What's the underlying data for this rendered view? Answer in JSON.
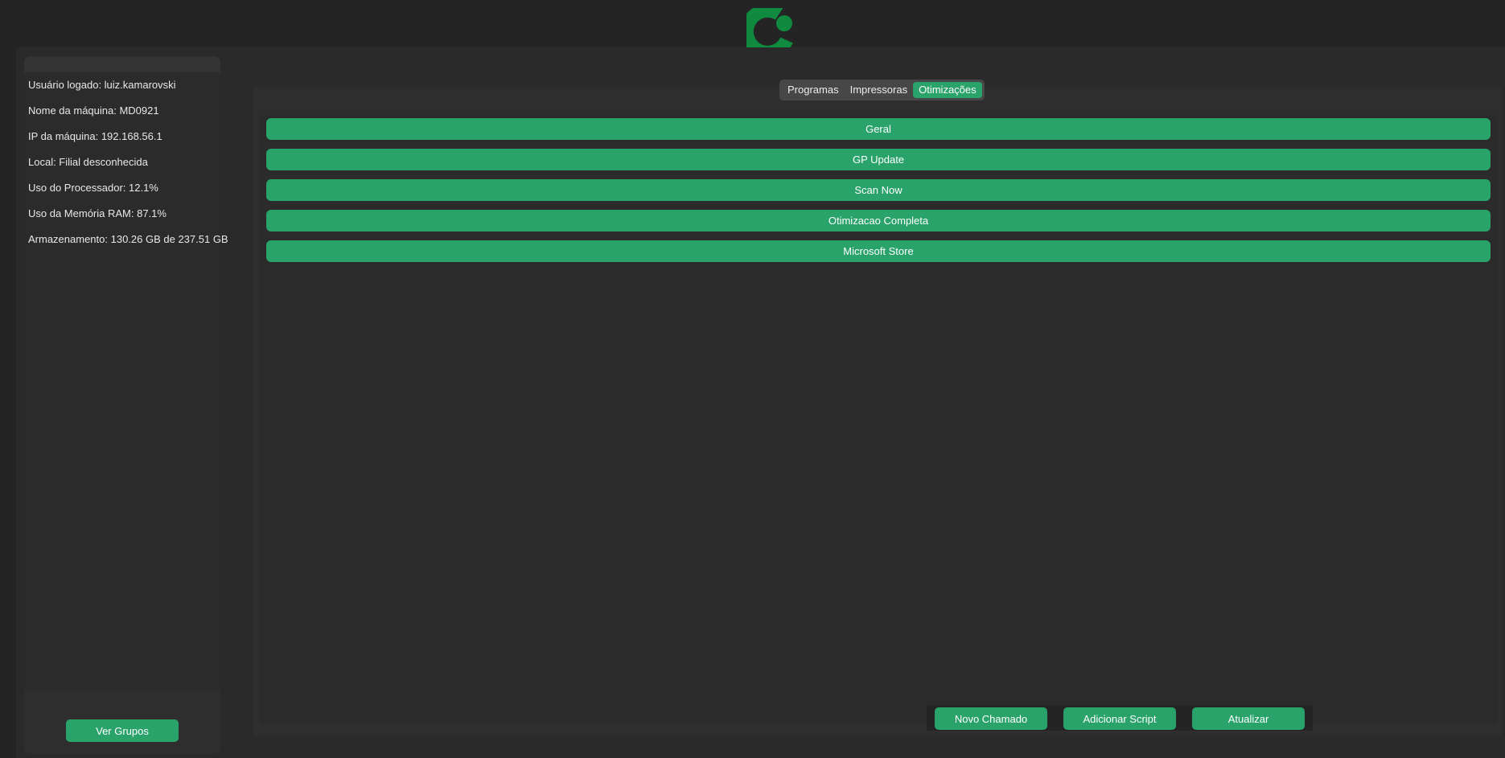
{
  "header": {
    "logo_icon": "app-logo-icon"
  },
  "sidebar": {
    "info": [
      "Usuário logado: luiz.kamarovski",
      "Nome da máquina: MD0921",
      "IP da máquina: 192.168.56.1",
      "Local: Filial desconhecida",
      "Uso do Processador: 12.1%",
      "Uso da Memória RAM: 87.1%",
      "Armazenamento: 130.26 GB de 237.51 GB"
    ],
    "ver_grupos_label": "Ver Grupos"
  },
  "tabs": {
    "items": [
      "Programas",
      "Impressoras",
      "Otimizações"
    ],
    "active": "Otimizações"
  },
  "options": [
    "Geral",
    "GP Update",
    "Scan Now",
    "Otimizacao Completa",
    "Microsoft Store"
  ],
  "actions": {
    "novo_chamado": "Novo Chamado",
    "adicionar_script": "Adicionar Script",
    "atualizar": "Atualizar"
  },
  "colors": {
    "accent": "#2aa36b",
    "logo": "#0f8a3f",
    "background": "#242424"
  }
}
